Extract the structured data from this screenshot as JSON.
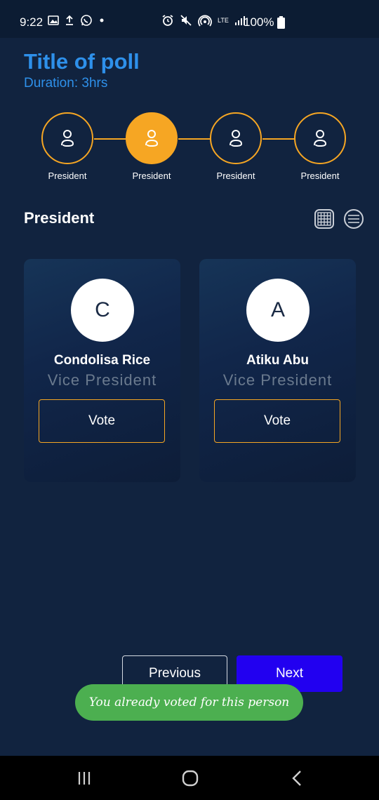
{
  "status_bar": {
    "time": "9:22",
    "battery": "100%",
    "network": "LTE",
    "icons": [
      "image-icon",
      "upload-icon",
      "whatsapp-icon",
      "dot-icon",
      "alarm-icon",
      "mute-icon",
      "hotspot-icon",
      "lte-icon",
      "signal-icon",
      "battery-icon"
    ]
  },
  "poll": {
    "title": "Title of poll",
    "duration": "Duration: 3hrs"
  },
  "steps": [
    {
      "label": "President",
      "active": false
    },
    {
      "label": "President",
      "active": true
    },
    {
      "label": "President",
      "active": false
    },
    {
      "label": "President",
      "active": false
    }
  ],
  "section": {
    "title": "President"
  },
  "candidates": [
    {
      "initial": "C",
      "name": "Condolisa Rice",
      "role": "Vice President",
      "vote_label": "Vote"
    },
    {
      "initial": "A",
      "name": "Atiku Abu",
      "role": "Vice President",
      "vote_label": "Vote"
    }
  ],
  "navigation": {
    "previous_label": "Previous",
    "next_label": "Next"
  },
  "toast": {
    "message": "You already voted for this person"
  },
  "colors": {
    "background": "#11233f",
    "accent": "#f6a623",
    "title": "#2e90ea",
    "next_button": "#2200f0",
    "toast": "#4caf50"
  }
}
